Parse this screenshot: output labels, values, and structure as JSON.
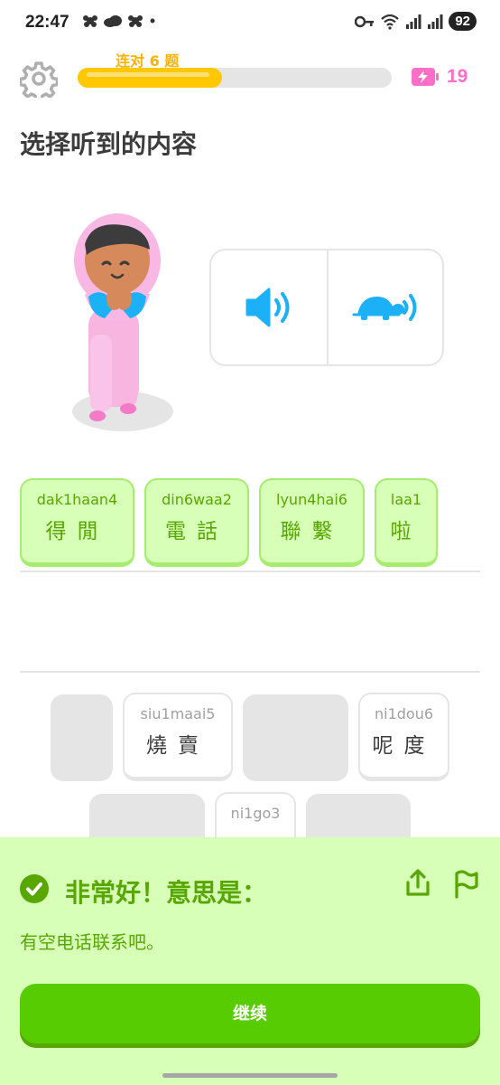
{
  "status_bar": {
    "time": "22:47",
    "battery": "92"
  },
  "header": {
    "streak_label": "连对 6 题",
    "progress_fraction": 0.46,
    "energy_count": "19",
    "progress_color": "#ffc800",
    "energy_color": "#ff6ec7"
  },
  "prompt": {
    "title": "选择听到的内容"
  },
  "selected_tiles": [
    {
      "roman": "dak1haan4",
      "chars": "得閒"
    },
    {
      "roman": "din6waa2",
      "chars": "電話"
    },
    {
      "roman": "lyun4hai6",
      "chars": "聯繫"
    },
    {
      "roman": "laa1",
      "chars": "啦"
    }
  ],
  "word_bank": [
    {
      "roman": "siu1maai5",
      "chars": "燒賣"
    },
    {
      "roman": "ni1dou6",
      "chars": "呢度"
    },
    {
      "roman": "ni1go3",
      "chars": ""
    }
  ],
  "feedback": {
    "title": "非常好！意思是：",
    "meaning": "有空电话联系吧。",
    "continue_label": "继续",
    "panel_color": "#d7ffb8",
    "accent_color": "#58a700",
    "button_color": "#58cc02"
  },
  "icons": {
    "settings": "gear-icon",
    "energy": "battery-bolt-icon",
    "audio_normal": "speaker-icon",
    "audio_slow": "turtle-icon",
    "check": "check-circle-icon",
    "share": "share-icon",
    "report": "flag-icon"
  }
}
